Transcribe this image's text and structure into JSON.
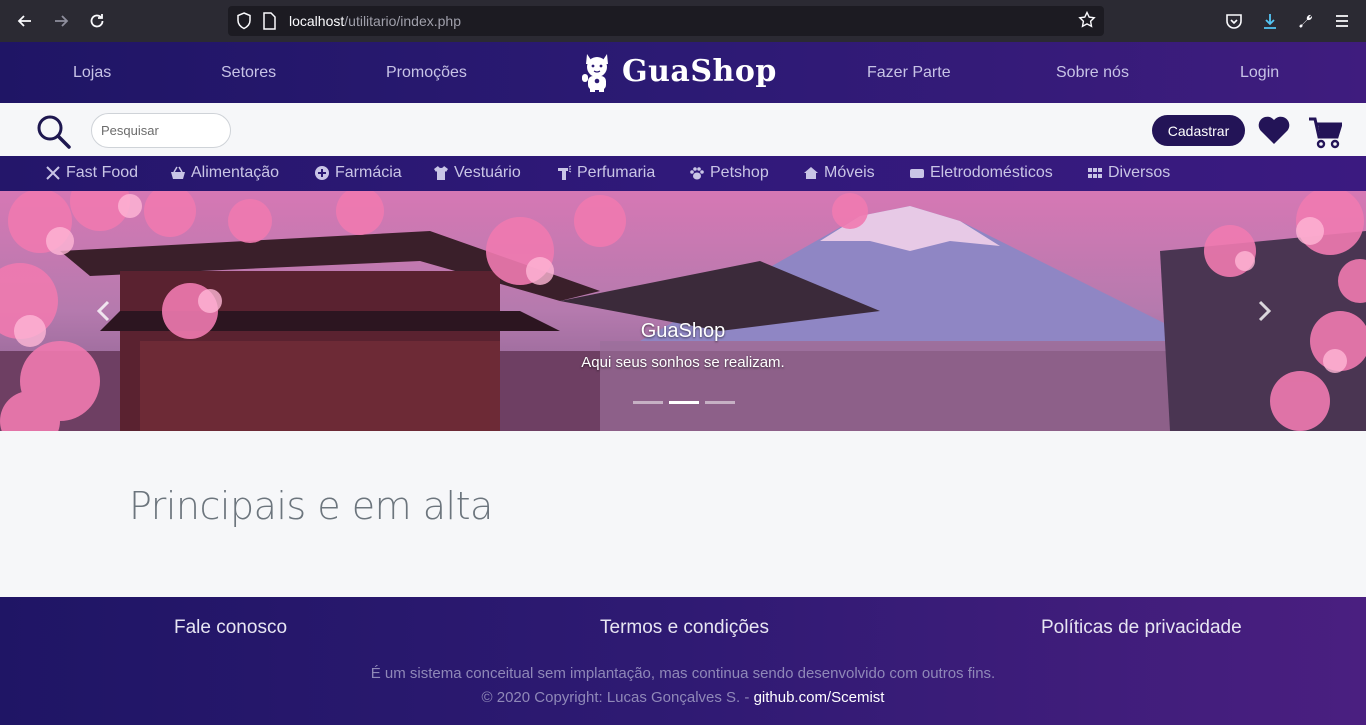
{
  "browser": {
    "url_host": "localhost",
    "url_path": "/utilitario/index.php"
  },
  "header": {
    "nav_left": [
      "Lojas",
      "Setores",
      "Promoções"
    ],
    "brand": "GuaShop",
    "nav_right": [
      "Fazer Parte",
      "Sobre nós",
      "Login"
    ]
  },
  "toolbar": {
    "search_placeholder": "Pesquisar",
    "register_label": "Cadastrar"
  },
  "categories": [
    {
      "label": "Fast Food",
      "icon": "utensils-icon"
    },
    {
      "label": "Alimentação",
      "icon": "basket-icon"
    },
    {
      "label": "Farmácia",
      "icon": "medical-icon"
    },
    {
      "label": "Vestuário",
      "icon": "shirt-icon"
    },
    {
      "label": "Perfumaria",
      "icon": "spray-icon"
    },
    {
      "label": "Petshop",
      "icon": "paw-icon"
    },
    {
      "label": "Móveis",
      "icon": "home-icon"
    },
    {
      "label": "Eletrodomésticos",
      "icon": "appliance-icon"
    },
    {
      "label": "Diversos",
      "icon": "grid-icon"
    }
  ],
  "hero": {
    "title": "GuaShop",
    "subtitle": "Aqui seus sonhos se realizam.",
    "active_slide": 2,
    "slide_count": 3
  },
  "main": {
    "section_title": "Principais e em alta"
  },
  "footer": {
    "links": [
      "Fale conosco",
      "Termos e condições",
      "Políticas de privacidade"
    ],
    "note": "É um sistema conceitual sem implantação, mas continua sendo desenvolvido com outros fins.",
    "copyright": "© 2020 Copyright: Lucas Gonçalves S. -",
    "github": "github.com/Scemist"
  },
  "colors": {
    "brand_purple": "#2c1a74",
    "button_dark": "#231457",
    "page_bg": "#f6f7f9"
  }
}
